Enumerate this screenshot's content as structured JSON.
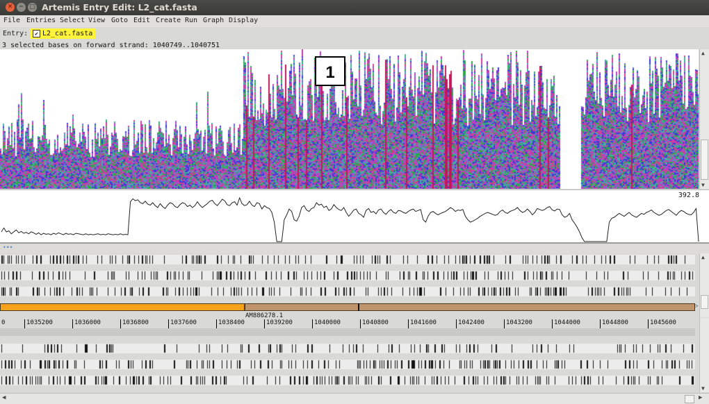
{
  "window": {
    "title": "Artemis Entry Edit: L2_cat.fasta"
  },
  "menubar": {
    "items": [
      "File",
      "Entries",
      "Select",
      "View",
      "Goto",
      "Edit",
      "Create",
      "Run",
      "Graph",
      "Display"
    ]
  },
  "entry": {
    "label": "Entry:",
    "name": "L2_cat.fasta",
    "checked": true
  },
  "status": {
    "text": "3 selected bases on forward strand: 1040749..1040751"
  },
  "callout": {
    "text": "1"
  },
  "graph": {
    "max_label": "392.8",
    "profile": [
      0.8,
      0.72,
      0.8,
      0.78,
      0.84,
      0.8,
      0.76,
      0.82,
      0.79,
      0.83,
      0.81,
      0.84,
      0.8,
      0.82,
      0.85,
      0.82,
      0.86,
      0.83,
      0.85,
      0.84,
      0.86,
      0.83,
      0.85,
      0.82,
      0.84,
      0.86,
      0.83,
      0.85,
      0.84,
      0.86,
      0.83,
      0.84,
      0.85,
      0.86,
      0.84,
      0.86,
      0.85,
      0.86,
      0.85,
      0.84,
      0.86,
      0.85,
      0.86,
      0.84,
      0.85,
      0.86,
      0.85,
      0.86,
      0.84,
      0.86,
      0.85,
      0.86,
      0.18,
      0.12,
      0.16,
      0.14,
      0.2,
      0.22,
      0.17,
      0.23,
      0.25,
      0.2,
      0.26,
      0.3,
      0.22,
      0.28,
      0.32,
      0.25,
      0.2,
      0.22,
      0.28,
      0.3,
      0.24,
      0.2,
      0.22,
      0.28,
      0.25,
      0.3,
      0.26,
      0.18,
      0.25,
      0.3,
      0.26,
      0.22,
      0.17,
      0.15,
      0.22,
      0.26,
      0.2,
      0.13,
      0.16,
      0.24,
      0.26,
      0.2,
      0.18,
      0.25,
      0.1,
      0.22,
      0.26,
      0.24,
      0.17,
      0.25,
      0.28,
      0.2,
      0.22,
      0.33,
      0.26,
      0.3,
      0.32,
      0.4,
      0.6,
      1.0,
      1.0,
      1.0,
      0.55,
      0.45,
      0.33,
      0.38,
      0.55,
      0.58,
      0.48,
      0.3,
      0.26,
      0.35,
      0.38,
      0.32,
      0.3,
      0.2,
      0.25,
      0.23,
      0.3,
      0.27,
      0.36,
      0.33,
      0.24,
      0.3,
      0.34,
      0.36,
      0.3,
      0.4,
      0.48,
      0.42,
      0.35,
      0.33,
      0.42,
      0.45,
      0.5,
      0.36,
      0.32,
      0.4,
      0.38,
      0.43,
      0.35,
      0.33,
      0.4,
      0.44,
      0.38,
      0.34,
      0.4,
      0.42,
      0.36,
      0.37,
      0.4,
      0.42,
      0.38,
      0.35,
      0.33,
      0.38,
      0.36,
      0.34,
      0.55,
      0.6,
      0.48,
      0.4,
      0.38,
      0.42,
      0.45,
      0.42,
      0.4,
      0.38,
      0.34,
      0.3,
      0.33,
      0.38,
      0.35,
      0.36,
      0.34,
      0.48,
      0.55,
      0.6,
      0.58,
      0.55,
      0.52,
      0.48,
      0.45,
      0.42,
      0.4,
      0.42,
      0.44,
      0.46,
      0.44,
      0.38,
      0.35,
      0.4,
      0.42,
      0.38,
      0.36,
      0.34,
      0.3,
      0.36,
      0.4,
      0.38,
      0.33,
      0.38,
      0.45,
      0.4,
      0.32,
      0.34,
      0.36,
      0.34,
      0.3,
      0.28,
      0.35,
      0.37,
      0.33,
      0.34,
      0.45,
      0.5,
      0.48,
      0.42,
      0.55,
      0.62,
      0.7,
      0.8,
      0.92,
      1.0,
      1.0,
      1.0,
      1.0,
      1.0,
      1.0,
      1.0,
      1.0,
      1.0,
      1.0,
      0.6,
      0.52,
      0.5,
      0.46,
      0.42,
      0.45,
      0.48,
      0.44,
      0.4,
      0.45,
      0.48,
      0.5,
      0.46,
      0.42,
      0.44,
      0.4,
      0.38,
      0.35,
      0.4,
      0.43,
      0.46,
      0.44,
      0.4,
      0.36,
      0.34,
      0.38,
      0.42,
      0.46,
      0.4,
      0.36,
      0.38,
      0.42,
      0.44,
      0.45,
      0.4,
      0.32,
      1.0
    ]
  },
  "feature": {
    "segments": [
      {
        "start_frac": 0.0,
        "end_frac": 0.352,
        "color": "#f5a21a"
      },
      {
        "start_frac": 0.352,
        "end_frac": 1.0,
        "color": "#c0956b"
      }
    ],
    "label": "AM886278.1"
  },
  "ruler": {
    "leading_label": "0",
    "ticks": [
      "1035200",
      "1036000",
      "1036800",
      "1037600",
      "1038400",
      "1039200",
      "1040000",
      "1040800",
      "1041600",
      "1042400",
      "1043200",
      "1044000",
      "1044800",
      "1045600"
    ]
  }
}
